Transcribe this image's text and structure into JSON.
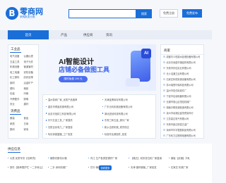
{
  "header": {
    "logo_mark": "B",
    "logo_title": "零商网",
    "logo_sub": "采购批发分类",
    "search_placeholder": "",
    "search_label": "搜索",
    "login_label": "免费注册",
    "register_label": "免费发布"
  },
  "nav": {
    "active": "首页",
    "items": [
      "产品",
      "供应商",
      "资讯"
    ]
  },
  "category": {
    "title": "工业品",
    "items": [
      "电气设备",
      "仪器仪表",
      "五金工具",
      "电子元件",
      "机械设备",
      "管道管材",
      "电工电器",
      "安防设备",
      "化工原料",
      "纺织皮革",
      "钢材",
      "冶金矿产",
      "塑料",
      "橡胶",
      "包装",
      "印刷",
      "汽摩配件",
      "照明",
      "农业",
      "建材"
    ],
    "title2": "消费品",
    "items2": [
      "服装",
      "食品",
      "家居",
      "日用",
      "数码",
      "家电"
    ]
  },
  "banner": {
    "title": "AI智能设计",
    "subtitle": "店铺必备做图工具",
    "pill": "限时免费 199 元",
    "ai_badge": "AI"
  },
  "links": {
    "col1": [
      "温州泵阀厂家_优质产品推荐",
      "重庆市得鑫机械有限公司",
      "北京天信精工科技有限公司",
      "乐兴五金工具_厂家直供",
      "沈阳吉优电力_厂家直营",
      "氧化锌避雷器_工厂批发"
    ],
    "col2": [
      "天津金博库存有限公司",
      "广东元利机械设备有限公司",
      "湖北锐创科技有限公司",
      "东莞三和五金_源头厂家",
      "新乡吉铁机械_现货供应",
      "标准件及紧固件_批发"
    ]
  },
  "merchants": {
    "title": "商家",
    "items": [
      "成都华义恒源水处理设备有限公司",
      "北京天地盛华钢结构有限公司",
      "东莞市好佳实业有限公司",
      "长沙洁通卫浴有限公司",
      "石家庄科恒机械设备有限公司",
      "苏州瑞恩环保科技有限公司",
      "温州市宏伟标准件厂",
      "宁波市佳诚电器有限公司",
      "无锡市惠山区恒信机械厂",
      "湖南中联机械制造有限公司",
      "泉州市泉港区鑫茂贸易商行",
      "江苏豪达电气有限公司",
      "东莞市鑫达精密五金厂",
      "深圳市华宇塑胶制品有限公司",
      "广东科力达照明电器有限公司"
    ]
  },
  "supply": {
    "title": "供应信息",
    "row1": [
      "大荔 优质专供【包邮货】",
      "钢筋切断机价格",
      "内江 生产各类型锅炉厂家",
      "【格达】双扣变位机厂家直销",
      "钢板【武钢】冷轧"
    ],
    "row2": [
      "铁件【钢承载护栏 一二手转让】",
      "二手 深圳机械厂",
      "巴中 铸铁阀门厂家",
      "天津 镀锌钢管_厂家批发",
      "石家庄 机械厂家"
    ],
    "scroll_label": "查看更多"
  }
}
